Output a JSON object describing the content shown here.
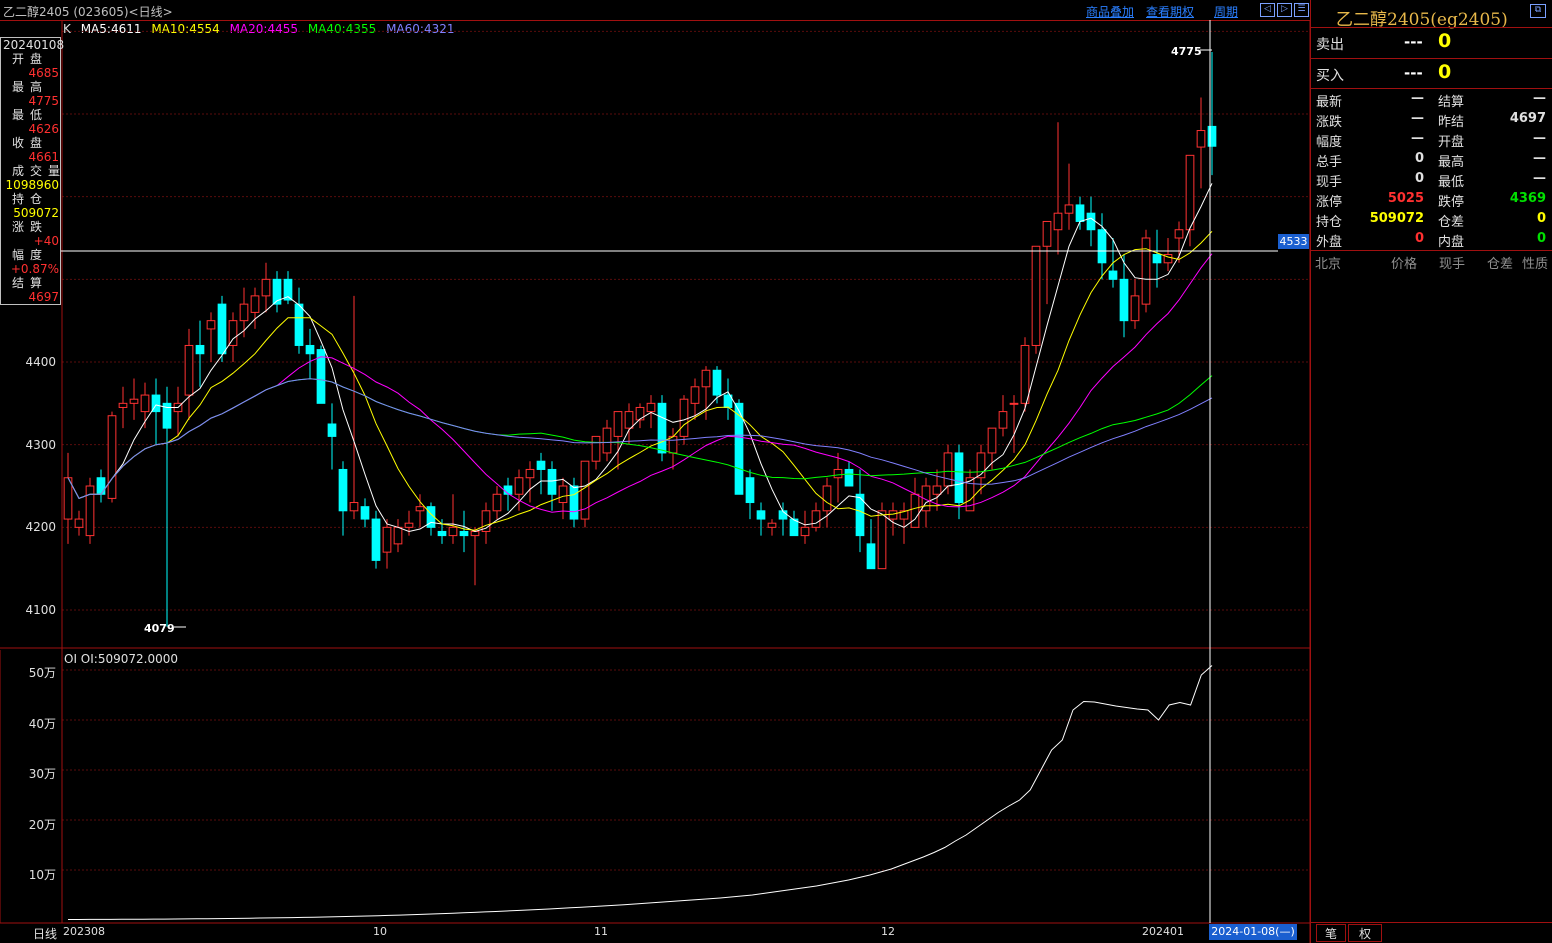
{
  "window": {
    "title": "乙二醇2405 (023605)<日线>",
    "links": [
      "商品叠加",
      "查看期权",
      "周期"
    ],
    "nav_buttons": [
      "◁",
      "▷",
      "☰"
    ]
  },
  "ma_legend": {
    "k": "K",
    "ma5": "MA5:4611",
    "ma10": "MA10:4554",
    "ma20": "MA20:4455",
    "ma40": "MA40:4355",
    "ma60": "MA60:4321",
    "colors": {
      "ma5": "#ffffff",
      "ma10": "#ffff00",
      "ma20": "#ff00ff",
      "ma40": "#00ff00",
      "ma60": "#8080ff"
    }
  },
  "info_panel": {
    "date": "20240108",
    "rows": [
      {
        "label": "开盘",
        "value": "4685",
        "color": "#ff3030"
      },
      {
        "label": "最高",
        "value": "4775",
        "color": "#ff3030"
      },
      {
        "label": "最低",
        "value": "4626",
        "color": "#ff3030"
      },
      {
        "label": "收盘",
        "value": "4661",
        "color": "#ff3030"
      },
      {
        "label": "成交量",
        "value": "1098960",
        "color": "#ffff00"
      },
      {
        "label": "持仓",
        "value": "509072",
        "color": "#ffff00"
      },
      {
        "label": "涨跌",
        "value": "+40",
        "color": "#ff3030"
      },
      {
        "label": "幅度",
        "value": "+0.87%",
        "color": "#ff3030"
      },
      {
        "label": "结算",
        "value": "4697",
        "color": "#ff3030"
      }
    ]
  },
  "price_axis": [
    "4400",
    "4300",
    "4200",
    "4100"
  ],
  "crosshair_price": "4533",
  "high_marker": "4775",
  "low_marker": "4079",
  "oi_panel": {
    "label": "OI OI:509072.0000",
    "axis": [
      "50万",
      "40万",
      "30万",
      "20万",
      "10万"
    ]
  },
  "x_axis": {
    "period": "日线",
    "ticks": [
      "202308",
      "10",
      "11",
      "12",
      "202401"
    ],
    "cursor_date": "2024-01-08(—)"
  },
  "quote": {
    "title": "乙二醇2405(eg2405)",
    "sell_label": "卖出",
    "sell_price": "---",
    "sell_qty": "0",
    "buy_label": "买入",
    "buy_price": "---",
    "buy_qty": "0",
    "rows": [
      {
        "l1": "最新",
        "v1": "—",
        "c1": "#e0e0e0",
        "l2": "结算",
        "v2": "—",
        "c2": "#e0e0e0"
      },
      {
        "l1": "涨跌",
        "v1": "—",
        "c1": "#e0e0e0",
        "l2": "昨结",
        "v2": "4697",
        "c2": "#e0e0e0"
      },
      {
        "l1": "幅度",
        "v1": "—",
        "c1": "#e0e0e0",
        "l2": "开盘",
        "v2": "—",
        "c2": "#e0e0e0"
      },
      {
        "l1": "总手",
        "v1": "0",
        "c1": "#e0e0e0",
        "l2": "最高",
        "v2": "—",
        "c2": "#e0e0e0"
      },
      {
        "l1": "现手",
        "v1": "0",
        "c1": "#e0e0e0",
        "l2": "最低",
        "v2": "—",
        "c2": "#e0e0e0"
      },
      {
        "l1": "涨停",
        "v1": "5025",
        "c1": "#ff3030",
        "l2": "跌停",
        "v2": "4369",
        "c2": "#00e000"
      },
      {
        "l1": "持仓",
        "v1": "509072",
        "c1": "#ffff00",
        "l2": "仓差",
        "v2": "0",
        "c2": "#ffff00"
      },
      {
        "l1": "外盘",
        "v1": "0",
        "c1": "#ff3030",
        "l2": "内盘",
        "v2": "0",
        "c2": "#00e000"
      }
    ],
    "tick_headers": [
      "北京",
      "价格",
      "现手",
      "仓差",
      "性质"
    ],
    "tabs": [
      "笔",
      "权"
    ]
  },
  "chart_data": {
    "type": "candlestick",
    "title": "",
    "ylim": [
      4050,
      4800
    ],
    "candles": [
      [
        4210,
        4290,
        4180,
        4260
      ],
      [
        4200,
        4220,
        4190,
        4210
      ],
      [
        4190,
        4260,
        4180,
        4250
      ],
      [
        4260,
        4270,
        4230,
        4240
      ],
      [
        4235,
        4340,
        4230,
        4335
      ],
      [
        4345,
        4370,
        4320,
        4350
      ],
      [
        4350,
        4380,
        4330,
        4355
      ],
      [
        4340,
        4375,
        4320,
        4360
      ],
      [
        4360,
        4380,
        4300,
        4340
      ],
      [
        4350,
        4370,
        4080,
        4320
      ],
      [
        4340,
        4370,
        4310,
        4350
      ],
      [
        4360,
        4440,
        4330,
        4420
      ],
      [
        4420,
        4450,
        4370,
        4410
      ],
      [
        4440,
        4460,
        4400,
        4450
      ],
      [
        4470,
        4480,
        4400,
        4410
      ],
      [
        4420,
        4460,
        4400,
        4450
      ],
      [
        4450,
        4490,
        4430,
        4470
      ],
      [
        4460,
        4490,
        4440,
        4480
      ],
      [
        4480,
        4520,
        4460,
        4500
      ],
      [
        4500,
        4510,
        4460,
        4470
      ],
      [
        4500,
        4510,
        4470,
        4475
      ],
      [
        4470,
        4490,
        4410,
        4420
      ],
      [
        4420,
        4440,
        4380,
        4410
      ],
      [
        4415,
        4420,
        4350,
        4350
      ],
      [
        4325,
        4350,
        4270,
        4310
      ],
      [
        4270,
        4280,
        4190,
        4220
      ],
      [
        4220,
        4480,
        4210,
        4230
      ],
      [
        4225,
        4235,
        4200,
        4210
      ],
      [
        4210,
        4220,
        4150,
        4160
      ],
      [
        4170,
        4210,
        4150,
        4200
      ],
      [
        4180,
        4210,
        4170,
        4200
      ],
      [
        4200,
        4220,
        4190,
        4205
      ],
      [
        4220,
        4240,
        4200,
        4225
      ],
      [
        4225,
        4230,
        4190,
        4200
      ],
      [
        4195,
        4210,
        4180,
        4190
      ],
      [
        4190,
        4240,
        4180,
        4200
      ],
      [
        4195,
        4220,
        4170,
        4190
      ],
      [
        4190,
        4200,
        4130,
        4195
      ],
      [
        4195,
        4230,
        4180,
        4220
      ],
      [
        4220,
        4250,
        4210,
        4240
      ],
      [
        4250,
        4260,
        4220,
        4240
      ],
      [
        4240,
        4270,
        4220,
        4260
      ],
      [
        4260,
        4280,
        4230,
        4270
      ],
      [
        4280,
        4290,
        4240,
        4270
      ],
      [
        4270,
        4280,
        4220,
        4240
      ],
      [
        4230,
        4260,
        4210,
        4250
      ],
      [
        4250,
        4260,
        4200,
        4210
      ],
      [
        4210,
        4250,
        4200,
        4280
      ],
      [
        4280,
        4310,
        4270,
        4310
      ],
      [
        4290,
        4330,
        4280,
        4320
      ],
      [
        4310,
        4340,
        4270,
        4340
      ],
      [
        4320,
        4350,
        4300,
        4340
      ],
      [
        4330,
        4350,
        4320,
        4345
      ],
      [
        4340,
        4360,
        4320,
        4350
      ],
      [
        4350,
        4360,
        4280,
        4290
      ],
      [
        4290,
        4320,
        4270,
        4310
      ],
      [
        4310,
        4360,
        4300,
        4355
      ],
      [
        4350,
        4380,
        4330,
        4370
      ],
      [
        4370,
        4395,
        4330,
        4390
      ],
      [
        4390,
        4395,
        4350,
        4360
      ],
      [
        4360,
        4380,
        4330,
        4345
      ],
      [
        4350,
        4355,
        4240,
        4240
      ],
      [
        4260,
        4270,
        4210,
        4230
      ],
      [
        4220,
        4230,
        4190,
        4210
      ],
      [
        4200,
        4210,
        4190,
        4205
      ],
      [
        4220,
        4230,
        4190,
        4210
      ],
      [
        4210,
        4220,
        4190,
        4190
      ],
      [
        4190,
        4220,
        4180,
        4200
      ],
      [
        4200,
        4230,
        4195,
        4220
      ],
      [
        4220,
        4260,
        4200,
        4250
      ],
      [
        4260,
        4290,
        4230,
        4270
      ],
      [
        4270,
        4280,
        4250,
        4250
      ],
      [
        4240,
        4270,
        4170,
        4190
      ],
      [
        4180,
        4210,
        4150,
        4150
      ],
      [
        4150,
        4230,
        4150,
        4220
      ],
      [
        4210,
        4230,
        4190,
        4220
      ],
      [
        4210,
        4230,
        4180,
        4220
      ],
      [
        4200,
        4260,
        4200,
        4240
      ],
      [
        4220,
        4260,
        4200,
        4250
      ],
      [
        4240,
        4270,
        4220,
        4250
      ],
      [
        4250,
        4300,
        4240,
        4290
      ],
      [
        4290,
        4300,
        4210,
        4230
      ],
      [
        4220,
        4270,
        4230,
        4260
      ],
      [
        4260,
        4300,
        4240,
        4290
      ],
      [
        4290,
        4320,
        4270,
        4320
      ],
      [
        4320,
        4360,
        4310,
        4340
      ],
      [
        4350,
        4360,
        4290,
        4350
      ],
      [
        4350,
        4430,
        4340,
        4420
      ],
      [
        4420,
        4520,
        4410,
        4540
      ],
      [
        4540,
        4560,
        4470,
        4570
      ],
      [
        4560,
        4690,
        4530,
        4580
      ],
      [
        4580,
        4640,
        4560,
        4590
      ],
      [
        4590,
        4600,
        4560,
        4570
      ],
      [
        4580,
        4600,
        4540,
        4560
      ],
      [
        4560,
        4580,
        4500,
        4520
      ],
      [
        4510,
        4550,
        4490,
        4500
      ],
      [
        4500,
        4530,
        4430,
        4450
      ],
      [
        4450,
        4500,
        4440,
        4480
      ],
      [
        4470,
        4560,
        4460,
        4550
      ],
      [
        4530,
        4560,
        4490,
        4520
      ],
      [
        4520,
        4550,
        4510,
        4530
      ],
      [
        4550,
        4570,
        4520,
        4560
      ],
      [
        4560,
        4640,
        4540,
        4650
      ],
      [
        4660,
        4720,
        4610,
        4680
      ],
      [
        4685,
        4775,
        4626,
        4661
      ]
    ],
    "oi_series": [
      1000,
      1100,
      1200,
      1250,
      1300,
      1400,
      1500,
      1600,
      1700,
      1800,
      2000,
      2200,
      2400,
      2600,
      2800,
      3000,
      3300,
      3600,
      3900,
      4200,
      4500,
      4800,
      5200,
      5600,
      6000,
      6500,
      7000,
      7500,
      8000,
      8600,
      9200,
      9800,
      10500,
      11200,
      12000,
      12800,
      13600,
      14400,
      15300,
      16200,
      17100,
      18000,
      19000,
      20000,
      21000,
      22000,
      23200,
      24400,
      25600,
      26800,
      28000,
      29300,
      30600,
      32000,
      33500,
      35000,
      36500,
      38000,
      39500,
      41000,
      42500,
      44000,
      46000,
      48000,
      50000,
      53000,
      56000,
      59000,
      62000,
      65000,
      68000,
      72000,
      76000,
      80000,
      85000,
      90000,
      96000,
      102000,
      110000,
      118000,
      126000,
      135000,
      145000,
      158000,
      170000,
      185000,
      200000,
      215000,
      228000,
      240000,
      260000,
      300000,
      340000,
      360000,
      420000,
      437000,
      436000,
      432000,
      428000,
      425000,
      422000,
      420000,
      400000,
      430000,
      435000,
      430000,
      490000,
      509072
    ]
  }
}
